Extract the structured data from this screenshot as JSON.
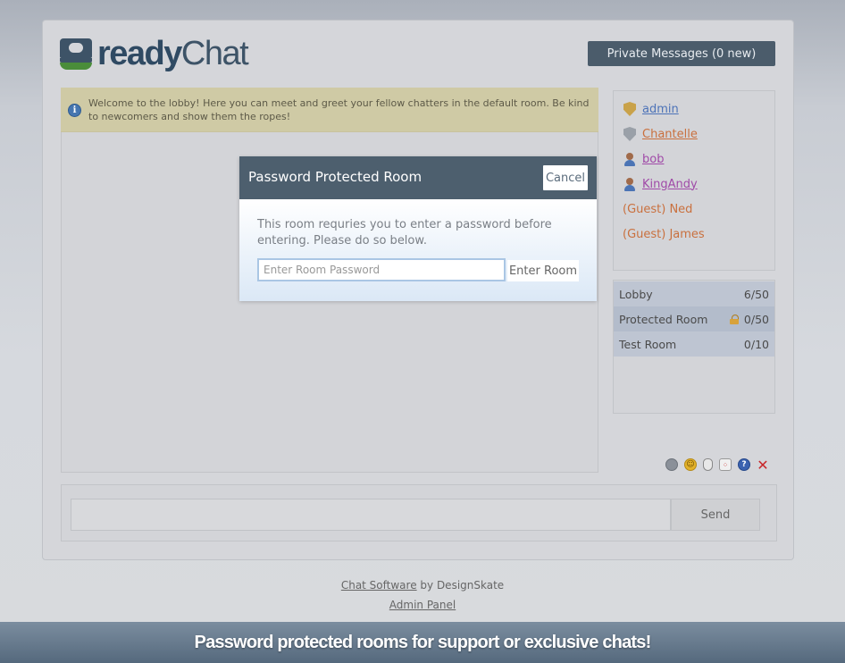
{
  "app": {
    "logo_text_a": "ready",
    "logo_text_b": "Chat",
    "private_messages_label": "Private Messages (0 new)"
  },
  "notice": {
    "text": "Welcome to the lobby! Here you can meet and greet your fellow chatters in the default room. Be kind to newcomers and show them the ropes!"
  },
  "users": [
    {
      "name": "admin",
      "role": "admin",
      "icon": "gold-shield-icon",
      "color": "#4d73b8"
    },
    {
      "name": "Chantelle",
      "role": "moderator",
      "icon": "silver-shield-icon",
      "color": "#c9703e"
    },
    {
      "name": "bob",
      "role": "member",
      "icon": "user-icon",
      "color": "#a04aa8"
    },
    {
      "name": "KingAndy",
      "role": "member",
      "icon": "user-icon",
      "color": "#a04aa8"
    },
    {
      "name": "(Guest) Ned",
      "role": "guest",
      "icon": "",
      "color": "#c9703e"
    },
    {
      "name": "(Guest) James",
      "role": "guest",
      "icon": "",
      "color": "#c9703e"
    }
  ],
  "rooms": [
    {
      "name": "Lobby",
      "count": "6/50",
      "locked": false
    },
    {
      "name": "Protected Room",
      "count": "0/50",
      "locked": true
    },
    {
      "name": "Test Room",
      "count": "0/10",
      "locked": false
    }
  ],
  "toolbar": {
    "icons": [
      "search-icon",
      "smiley-icon",
      "mouse-icon",
      "dice-icon",
      "help-icon",
      "close-icon"
    ],
    "help_glyph": "?",
    "close_glyph": "✕"
  },
  "composer": {
    "message_value": "",
    "send_label": "Send"
  },
  "footer": {
    "link_label": "Chat Software",
    "by_text": " by DesignSkate",
    "admin_label": "Admin Panel"
  },
  "banner": {
    "text": "Password protected rooms for support or exclusive chats!"
  },
  "modal": {
    "title": "Password Protected Room",
    "cancel_label": "Cancel",
    "message": "This room requries you to enter a password before entering. Please do so below.",
    "password_placeholder": "Enter Room Password",
    "password_value": "",
    "enter_label": "Enter Room"
  }
}
